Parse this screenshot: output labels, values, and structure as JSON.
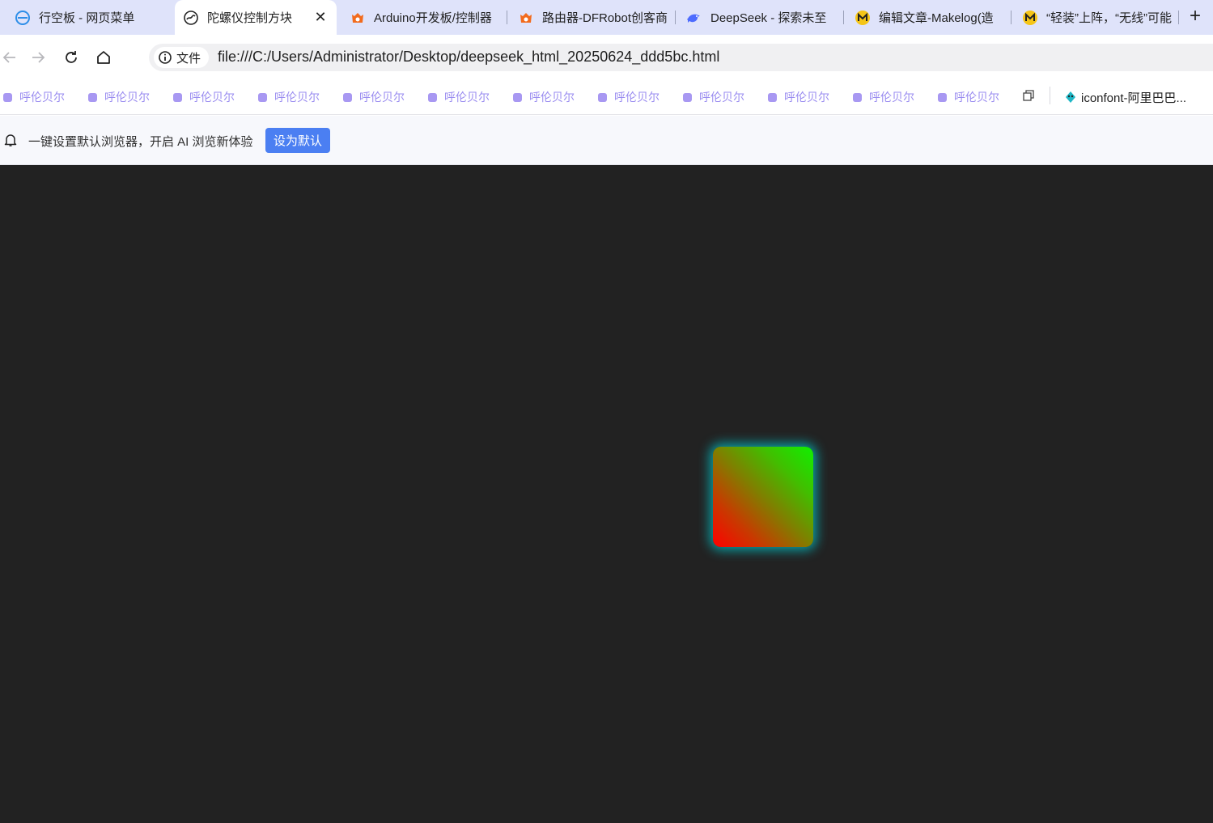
{
  "browser": {
    "tabs": [
      {
        "title": "行空板 - 网页菜单",
        "icon": "globe-icon",
        "active": false
      },
      {
        "title": "陀螺仪控制方块",
        "icon": "gyro-page-icon",
        "active": true,
        "close": "✕"
      },
      {
        "title": "Arduino开发板/控制器",
        "icon": "dfrobot-icon",
        "active": false
      },
      {
        "title": "路由器-DFRobot创客商",
        "icon": "dfrobot-icon",
        "active": false
      },
      {
        "title": "DeepSeek - 探索未至",
        "icon": "deepseek-whale-icon",
        "active": false
      },
      {
        "title": "编辑文章-Makelog(造",
        "icon": "makelog-icon",
        "active": false
      },
      {
        "title": "“轻装”上阵，“无线”可能",
        "icon": "makelog-icon",
        "active": false
      }
    ],
    "new_tab": "+",
    "address_bar": {
      "site_chip": "文件",
      "url": "file:///C:/Users/Administrator/Desktop/deepseek_html_20250624_ddd5bc.html"
    },
    "bookmarks": [
      "呼伦贝尔",
      "呼伦贝尔",
      "呼伦贝尔",
      "呼伦贝尔",
      "呼伦贝尔",
      "呼伦贝尔",
      "呼伦贝尔",
      "呼伦贝尔",
      "呼伦贝尔",
      "呼伦贝尔",
      "呼伦贝尔",
      "呼伦贝尔"
    ],
    "bookmark_extra": "iconfont-阿里巴巴...",
    "infobar": {
      "message": "一键设置默认浏览器，开启 AI 浏览新体验",
      "button": "设为默认"
    }
  },
  "page": {
    "background": "#222222",
    "cube": {
      "gradient_colors": [
        "#ff0000",
        "#10f000"
      ],
      "glow_color": "#00c8cd"
    }
  }
}
